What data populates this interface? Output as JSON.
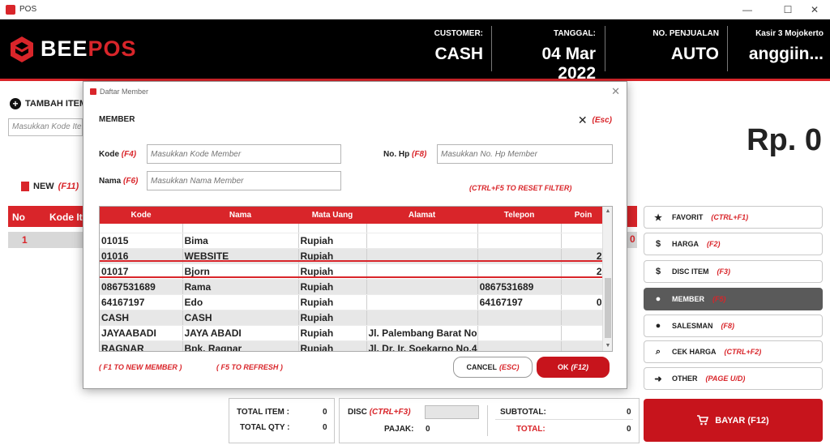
{
  "window": {
    "title": "POS",
    "controls": [
      "—",
      "☐",
      "✕"
    ]
  },
  "header": {
    "logo_bee": "BEE",
    "logo_pos": "POS",
    "customer_label": "CUSTOMER:",
    "customer_value": "CASH",
    "tanggal_label": "TANGGAL:",
    "tanggal_value": "04 Mar 2022",
    "penjualan_label": "NO. PENJUALAN",
    "penjualan_value": "AUTO",
    "kasir_label": "Kasir 3 Mojokerto",
    "kasir_value": "anggiin..."
  },
  "main": {
    "tambah_label": "TAMBAH ITEM",
    "item_placeholder": "Masukkan Kode Item",
    "total_display": "Rp. 0",
    "new_label": "NEW",
    "new_key": "(F11)",
    "table_headers": [
      "No",
      "Kode Item"
    ],
    "row_no": "1",
    "row_right_value": "0"
  },
  "sidebar": [
    {
      "icon": "star-icon",
      "glyph": "★",
      "label": "FAVORIT",
      "key": "(CTRL+F1)",
      "active": false
    },
    {
      "icon": "price-tag-icon",
      "glyph": "$",
      "label": "HARGA",
      "key": "(F2)",
      "active": false
    },
    {
      "icon": "discount-icon",
      "glyph": "$",
      "label": "DISC ITEM",
      "key": "(F3)",
      "active": false
    },
    {
      "icon": "person-icon",
      "glyph": "●",
      "label": "MEMBER",
      "key": "(F5)",
      "active": true
    },
    {
      "icon": "salesman-icon",
      "glyph": "●",
      "label": "SALESMAN",
      "key": "(F8)",
      "active": false
    },
    {
      "icon": "search-icon",
      "glyph": "⌕",
      "label": "CEK HARGA",
      "key": "(CTRL+F2)",
      "active": false
    },
    {
      "icon": "arrow-right-icon",
      "glyph": "➜",
      "label": "OTHER",
      "key": "(PAGE U/D)",
      "active": false
    }
  ],
  "bayar": {
    "label": "BAYAR (F12)",
    "icon": "cart-icon"
  },
  "footer": {
    "total_item_label": "TOTAL ITEM :",
    "total_item_value": "0",
    "total_qty_label": "TOTAL QTY :",
    "total_qty_value": "0",
    "disc_label": "DISC",
    "disc_key": "(CTRL+F3)",
    "disc_value": "",
    "pajak_label": "PAJAK:",
    "pajak_value": "0",
    "subtotal_label": "SUBTOTAL:",
    "subtotal_value": "0",
    "total_label": "TOTAL:",
    "total_value": "0"
  },
  "modal": {
    "window_title": "Daftar Member",
    "heading": "MEMBER",
    "esc_key": "(Esc)",
    "kode_label": "Kode",
    "kode_key": "(F4)",
    "kode_placeholder": "Masukkan Kode Member",
    "nohp_label": "No. Hp",
    "nohp_key": "(F8)",
    "nohp_placeholder": "Masukkan No. Hp Member",
    "nama_label": "Nama",
    "nama_key": "(F6)",
    "nama_placeholder": "Masukkan Nama Member",
    "reset_hint": "(CTRL+F5 TO RESET FILTER)",
    "columns": [
      "Kode",
      "Nama",
      "Mata Uang",
      "Alamat",
      "Telepon",
      "Poin"
    ],
    "rows": [
      {
        "kode": "01015",
        "nama": "Bima",
        "mata_uang": "Rupiah",
        "alamat": "",
        "telepon": "",
        "poin": ""
      },
      {
        "kode": "01016",
        "nama": "WEBSITE",
        "mata_uang": "Rupiah",
        "alamat": "",
        "telepon": "",
        "poin": "2"
      },
      {
        "kode": "01017",
        "nama": "Bjorn",
        "mata_uang": "Rupiah",
        "alamat": "",
        "telepon": "",
        "poin": "2"
      },
      {
        "kode": "0867531689",
        "nama": "Rama",
        "mata_uang": "Rupiah",
        "alamat": "",
        "telepon": "0867531689",
        "poin": ""
      },
      {
        "kode": "64167197",
        "nama": "Edo",
        "mata_uang": "Rupiah",
        "alamat": "",
        "telepon": "64167197",
        "poin": "0"
      },
      {
        "kode": "CASH",
        "nama": "CASH",
        "mata_uang": "Rupiah",
        "alamat": "",
        "telepon": "",
        "poin": ""
      },
      {
        "kode": "JAYAABADI",
        "nama": "JAYA ABADI",
        "mata_uang": "Rupiah",
        "alamat": "Jl. Palembang Barat No",
        "telepon": "",
        "poin": ""
      },
      {
        "kode": "RAGNAR",
        "nama": "Bpk. Ragnar",
        "mata_uang": "Rupiah",
        "alamat": "Jl. Dr. Ir. Soekarno No.4",
        "telepon": "",
        "poin": ""
      }
    ],
    "new_member_hint": "( F1 TO NEW MEMBER )",
    "refresh_hint": "( F5 TO REFRESH )",
    "cancel_label": "CANCEL",
    "cancel_key": "(ESC)",
    "ok_label": "OK",
    "ok_key": "(F12)"
  },
  "colors": {
    "brand_red": "#d9252a",
    "header_black": "#000000",
    "active_gray": "#5a5a5a"
  }
}
